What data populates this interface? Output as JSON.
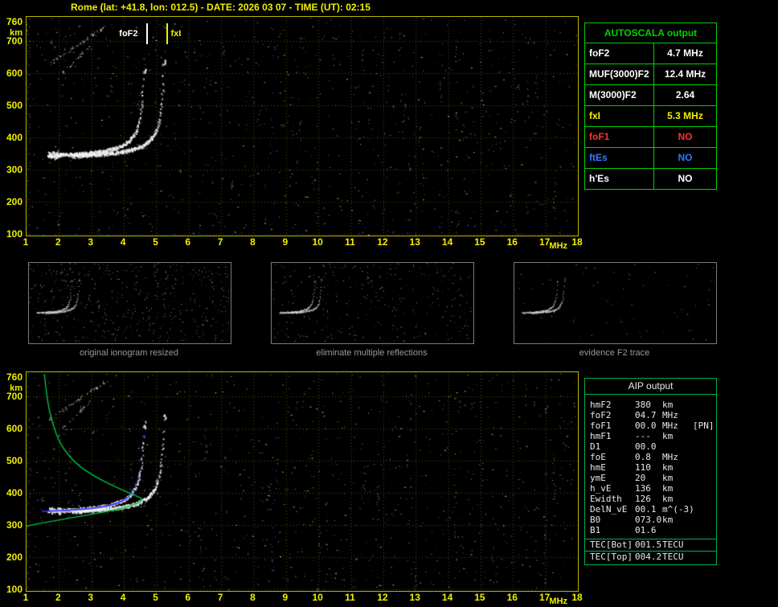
{
  "title": "Rome (lat: +41.8, lon: 012.5) - DATE: 2026 03 07 - TIME (UT): 02:15",
  "colors": {
    "axis_yellow": "#f0f000",
    "border_yellow": "#b6b600",
    "table_green": "#00d000",
    "aip_green": "#00b050",
    "no_red": "#ff3030",
    "es_blue": "#3377ff",
    "profile_green": "#00c040",
    "model_blue": "#2b2bff",
    "echo_white": "#f2f2f2"
  },
  "ionogram": {
    "x_ticks": [
      1,
      2,
      3,
      4,
      5,
      6,
      7,
      8,
      9,
      10,
      11,
      12,
      13,
      14,
      15,
      16,
      17,
      18
    ],
    "y_ticks": [
      760,
      700,
      600,
      500,
      400,
      300,
      200,
      100
    ],
    "x_unit": "MHz",
    "y_unit": "km",
    "markers": {
      "foF2_label": "foF2",
      "foF2_mhz": 4.7,
      "fxI_label": "fxI",
      "fxI_mhz": 5.3
    }
  },
  "autoscala": {
    "title": "AUTOSCALA output",
    "rows": [
      {
        "label": "foF2",
        "value": "4.7 MHz"
      },
      {
        "label": "MUF(3000)F2",
        "value": "12.4 MHz"
      },
      {
        "label": "M(3000)F2",
        "value": "2.64"
      },
      {
        "label": "fxI",
        "value": "5.3 MHz"
      },
      {
        "label": "foF1",
        "value": "NO"
      },
      {
        "label": "ftEs",
        "value": "NO"
      },
      {
        "label": "h'Es",
        "value": "NO"
      }
    ]
  },
  "thumbnails": [
    {
      "caption": "original ionogram resized"
    },
    {
      "caption": "eliminate multiple reflections"
    },
    {
      "caption": "evidence F2 trace"
    }
  ],
  "aip": {
    "title": "AIP output",
    "rows": [
      {
        "name": "hmF2",
        "value": "380",
        "unit": "km",
        "extra": ""
      },
      {
        "name": "foF2",
        "value": "04.7",
        "unit": "MHz",
        "extra": ""
      },
      {
        "name": "foF1",
        "value": "00.0",
        "unit": "MHz",
        "extra": "[PN]"
      },
      {
        "name": "hmF1",
        "value": "---",
        "unit": "km",
        "extra": ""
      },
      {
        "name": "D1",
        "value": "00.0",
        "unit": "",
        "extra": ""
      },
      {
        "name": "foE",
        "value": "0.8",
        "unit": "MHz",
        "extra": ""
      },
      {
        "name": "hmE",
        "value": "110",
        "unit": "km",
        "extra": ""
      },
      {
        "name": "ymE",
        "value": "20",
        "unit": "km",
        "extra": ""
      },
      {
        "name": "h_vE",
        "value": "136",
        "unit": "km",
        "extra": ""
      },
      {
        "name": "Ewidth",
        "value": "126",
        "unit": "km",
        "extra": ""
      },
      {
        "name": "DelN_vE",
        "value": "00.1",
        "unit": "m^(-3)",
        "extra": ""
      },
      {
        "name": "B0",
        "value": "073.0",
        "unit": "km",
        "extra": ""
      },
      {
        "name": "B1",
        "value": "01.6",
        "unit": "",
        "extra": ""
      },
      {
        "name": "TEC[Bot]",
        "value": "001.5",
        "unit": "TECU",
        "extra": ""
      },
      {
        "name": "TEC[Top]",
        "value": "004.2",
        "unit": "TECU",
        "extra": ""
      }
    ]
  },
  "chart_data": {
    "type": "scatter",
    "description": "vertical incidence ionogram echo traces (virtual height km vs frequency MHz)",
    "x_range_mhz": [
      1,
      18
    ],
    "y_range_km": [
      100,
      760
    ],
    "o_trace": {
      "f_start": 1.65,
      "f_critical": 4.7,
      "h_base_km": 332
    },
    "x_trace": {
      "f_start": 2.4,
      "f_critical": 5.3,
      "h_base_km": 330
    },
    "foF2_mhz": 4.7,
    "fxI_mhz": 5.3,
    "hmF2_km": 380,
    "profile_f_h": [
      [
        1.55,
        770
      ],
      [
        1.62,
        700
      ],
      [
        1.78,
        620
      ],
      [
        2.05,
        548
      ],
      [
        2.5,
        492
      ],
      [
        3.1,
        450
      ],
      [
        3.8,
        416
      ],
      [
        4.35,
        392
      ],
      [
        4.62,
        380
      ],
      [
        4.35,
        362
      ],
      [
        3.5,
        342
      ],
      [
        2.6,
        326
      ],
      [
        1.8,
        312
      ],
      [
        1.15,
        300
      ],
      [
        1.0,
        296
      ]
    ]
  }
}
